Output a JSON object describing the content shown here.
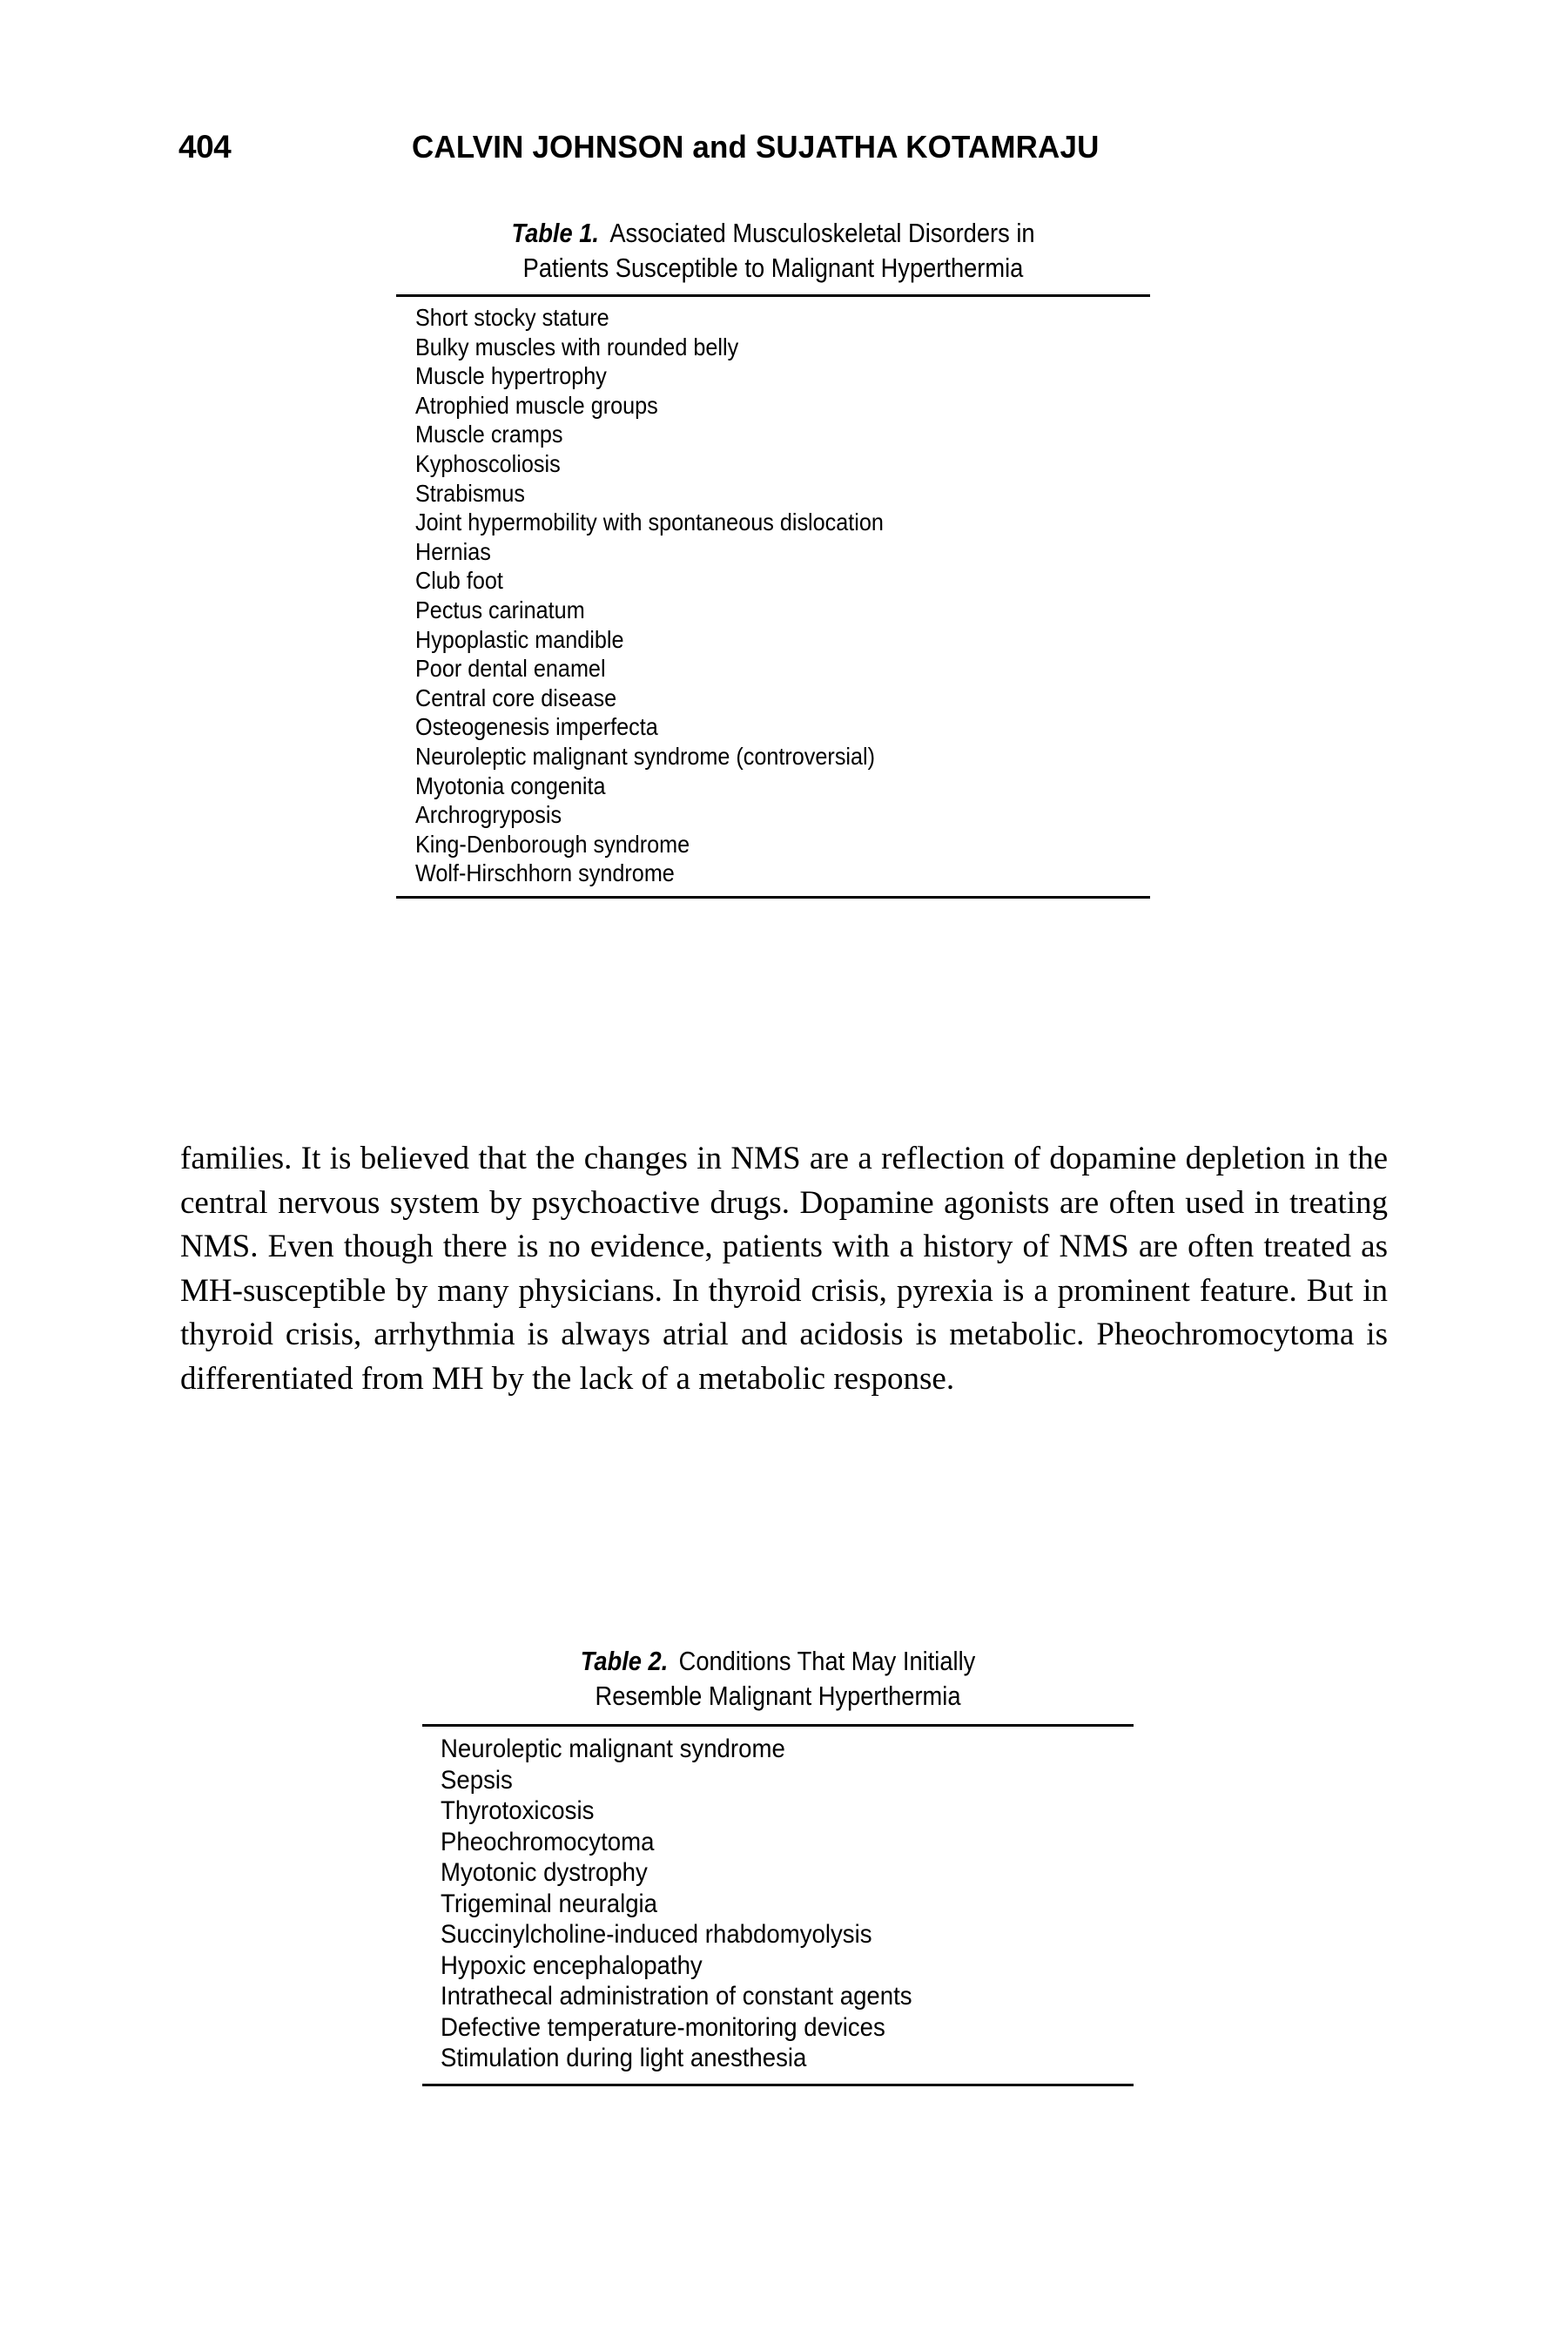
{
  "page": {
    "folio": "404",
    "running_head": "CALVIN JOHNSON and SUJATHA KOTAMRAJU"
  },
  "table_1": {
    "label": "Table 1.",
    "caption_line_1": "Associated Musculoskeletal Disorders in",
    "caption_line_2": "Patients Susceptible to Malignant Hyperthermia",
    "rows": [
      "Short stocky stature",
      "Bulky muscles with rounded belly",
      "Muscle hypertrophy",
      "Atrophied muscle groups",
      "Muscle cramps",
      "Kyphoscoliosis",
      "Strabismus",
      "Joint hypermobility with spontaneous dislocation",
      "Hernias",
      "Club foot",
      "Pectus carinatum",
      "Hypoplastic mandible",
      "Poor dental enamel",
      "Central core disease",
      "Osteogenesis imperfecta",
      "Neuroleptic malignant syndrome (controversial)",
      "Myotonia congenita",
      "Archrogryposis",
      "King-Denborough syndrome",
      "Wolf-Hirschhorn syndrome"
    ]
  },
  "body": {
    "paragraph": "families. It is believed that the changes in NMS are a reflection of dopamine depletion in the central nervous system by psychoactive drugs. Dopamine agonists are often used in treating NMS. Even though there is no evidence, patients with a history of NMS are often treated as MH-susceptible by many physicians. In thyroid crisis, pyrexia is a prominent feature. But in thyroid crisis, arrhythmia is always atrial and acidosis is metabolic. Pheochromocytoma is differentiated from MH by the lack of a metabolic response."
  },
  "table_2": {
    "label": "Table 2.",
    "caption_line_1": "Conditions That May Initially",
    "caption_line_2": "Resemble Malignant Hyperthermia",
    "rows": [
      "Neuroleptic malignant syndrome",
      "Sepsis",
      "Thyrotoxicosis",
      "Pheochromocytoma",
      "Myotonic dystrophy",
      "Trigeminal neuralgia",
      "Succinylcholine-induced rhabdomyolysis",
      "Hypoxic encephalopathy",
      "Intrathecal administration of constant agents",
      "Defective temperature-monitoring devices",
      "Stimulation during light anesthesia"
    ]
  }
}
